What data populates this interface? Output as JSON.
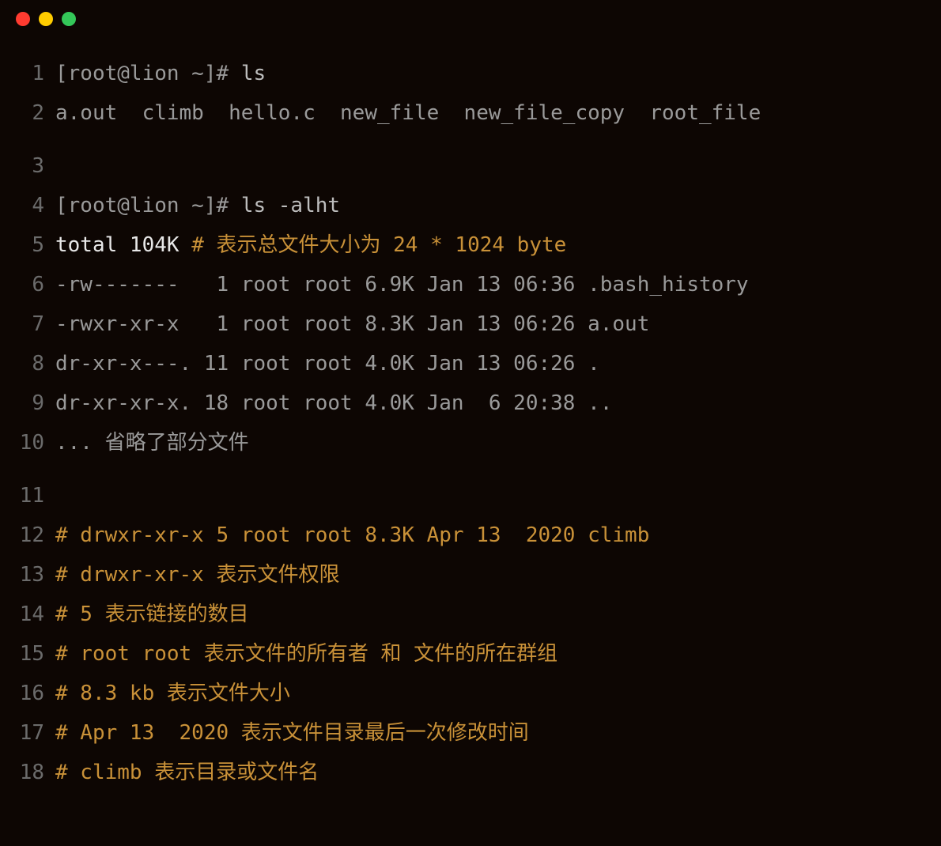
{
  "titlebar": {
    "colors": {
      "red": "#ff3b30",
      "yellow": "#ffcc00",
      "green": "#34c759"
    }
  },
  "lines": [
    {
      "no": "1",
      "segments": [
        {
          "cls": "prompt",
          "text": "[root@lion ~]# "
        },
        {
          "cls": "cmd",
          "text": "ls"
        }
      ]
    },
    {
      "no": "2",
      "segments": [
        {
          "cls": "output",
          "text": "a.out  climb  hello.c  new_file  new_file_copy  root_file"
        }
      ]
    },
    {
      "no": "3",
      "segments": []
    },
    {
      "no": "4",
      "segments": [
        {
          "cls": "prompt",
          "text": "[root@lion ~]# "
        },
        {
          "cls": "cmd",
          "text": "ls -alht"
        }
      ]
    },
    {
      "no": "5",
      "segments": [
        {
          "cls": "total",
          "text": "total 104K "
        },
        {
          "cls": "comment",
          "text": "# 表示总文件大小为 24 * 1024 byte"
        }
      ]
    },
    {
      "no": "6",
      "segments": [
        {
          "cls": "output",
          "text": "-rw-------   1 root root 6.9K Jan 13 06:36 .bash_history"
        }
      ]
    },
    {
      "no": "7",
      "segments": [
        {
          "cls": "output",
          "text": "-rwxr-xr-x   1 root root 8.3K Jan 13 06:26 a.out"
        }
      ]
    },
    {
      "no": "8",
      "segments": [
        {
          "cls": "output",
          "text": "dr-xr-x---. 11 root root 4.0K Jan 13 06:26 ."
        }
      ]
    },
    {
      "no": "9",
      "segments": [
        {
          "cls": "output",
          "text": "dr-xr-xr-x. 18 root root 4.0K Jan  6 20:38 .."
        }
      ]
    },
    {
      "no": "10",
      "segments": [
        {
          "cls": "output",
          "text": "... 省略了部分文件"
        }
      ]
    },
    {
      "no": "11",
      "segments": []
    },
    {
      "no": "12",
      "segments": [
        {
          "cls": "comment",
          "text": "# drwxr-xr-x 5 root root 8.3K Apr 13  2020 climb"
        }
      ]
    },
    {
      "no": "13",
      "segments": [
        {
          "cls": "comment",
          "text": "# drwxr-xr-x 表示文件权限"
        }
      ]
    },
    {
      "no": "14",
      "segments": [
        {
          "cls": "comment",
          "text": "# 5 表示链接的数目"
        }
      ]
    },
    {
      "no": "15",
      "segments": [
        {
          "cls": "comment",
          "text": "# root root 表示文件的所有者 和 文件的所在群组"
        }
      ]
    },
    {
      "no": "16",
      "segments": [
        {
          "cls": "comment",
          "text": "# 8.3 kb 表示文件大小"
        }
      ]
    },
    {
      "no": "17",
      "segments": [
        {
          "cls": "comment",
          "text": "# Apr 13  2020 表示文件目录最后一次修改时间"
        }
      ]
    },
    {
      "no": "18",
      "segments": [
        {
          "cls": "comment",
          "text": "# climb 表示目录或文件名"
        }
      ]
    }
  ]
}
